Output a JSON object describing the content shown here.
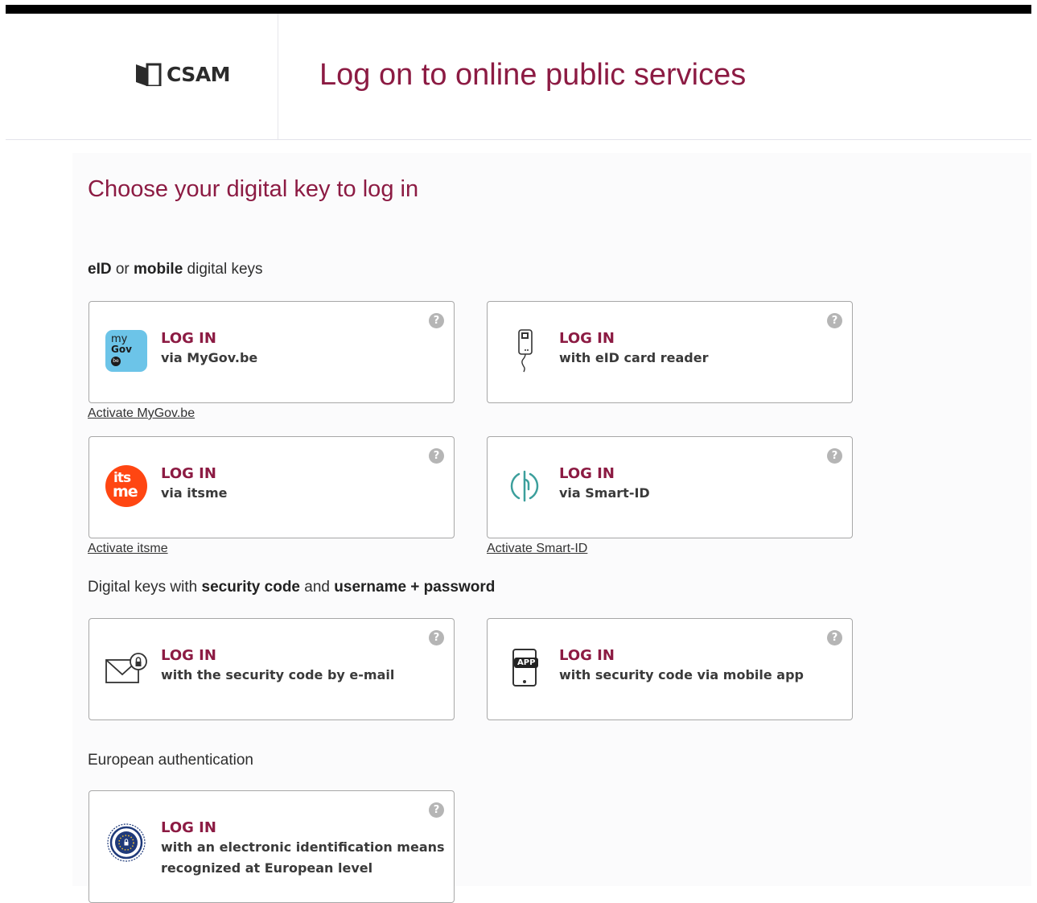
{
  "header": {
    "logo_text": "CSAM",
    "title": "Log on to online public services"
  },
  "page_title": "Choose your digital key to log in",
  "sections": {
    "eid": {
      "strong1": "eID",
      "mid": " or ",
      "strong2": "mobile",
      "tail": " digital keys"
    },
    "codes": {
      "pre": "Digital keys with ",
      "strong1": "security code",
      "mid": " and ",
      "strong2": "username + password"
    },
    "european": {
      "label": "European authentication"
    }
  },
  "cards": {
    "mygov": {
      "line1": "LOG IN",
      "line2": "via MyGov.be",
      "icon_text_top": "my",
      "icon_text_bottom": "Gov",
      "icon_badge": "be",
      "activate": "Activate MyGov.be"
    },
    "eid_reader": {
      "line1": "LOG IN",
      "line2": "with eID card reader"
    },
    "itsme": {
      "line1": "LOG IN",
      "line2": "via itsme",
      "icon_text_top": "its",
      "icon_text_bottom": "me",
      "activate": "Activate itsme"
    },
    "smartid": {
      "line1": "LOG IN",
      "line2": "via Smart-ID",
      "activate": "Activate Smart-ID"
    },
    "email_code": {
      "line1": "LOG IN",
      "line2": "with the security code by e-mail"
    },
    "app_code": {
      "line1": "LOG IN",
      "line2": "with security code via mobile app",
      "icon_text": "APP"
    },
    "eidas": {
      "line1": "LOG IN",
      "line2a": "with an electronic identification means",
      "line2b": "recognized at European level"
    }
  },
  "help_glyph": "?",
  "colors": {
    "brand": "#8c1b43",
    "mygov_bg": "#6cc4e8",
    "itsme_bg": "#ff4612",
    "smartid": "#3c9f9c",
    "eu_blue": "#1f3a7a"
  }
}
